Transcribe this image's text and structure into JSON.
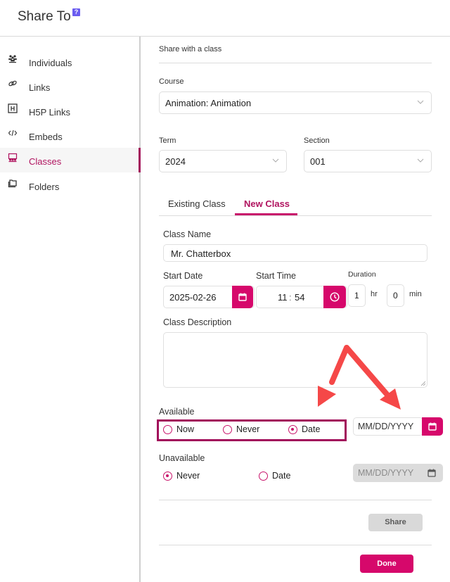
{
  "header": {
    "title": "Share To",
    "help_icon": "question-icon"
  },
  "sidebar": {
    "items": [
      {
        "label": "Individuals",
        "icon": "people-icon",
        "active": false
      },
      {
        "label": "Links",
        "icon": "link-icon",
        "active": false
      },
      {
        "label": "H5P Links",
        "icon": "h5p-icon",
        "active": false
      },
      {
        "label": "Embeds",
        "icon": "code-icon",
        "active": false
      },
      {
        "label": "Classes",
        "icon": "classroom-icon",
        "active": true
      },
      {
        "label": "Folders",
        "icon": "folder-icon",
        "active": false
      }
    ]
  },
  "main": {
    "section_title": "Share with a class",
    "course": {
      "label": "Course",
      "value": "Animation: Animation"
    },
    "term": {
      "label": "Term",
      "value": "2024"
    },
    "section": {
      "label": "Section",
      "value": "001"
    },
    "tabs": [
      {
        "label": "Existing Class",
        "active": false
      },
      {
        "label": "New Class",
        "active": true
      }
    ],
    "class_name": {
      "label": "Class Name",
      "value": "Mr. Chatterbox"
    },
    "start_date": {
      "label": "Start Date",
      "value": "2025-02-26"
    },
    "start_time": {
      "label": "Start Time",
      "hour": "11",
      "separator": ":",
      "minute": "54"
    },
    "duration": {
      "label": "Duration",
      "hours": "1",
      "hours_unit": "hr",
      "minutes": "0",
      "minutes_unit": "min"
    },
    "class_description": {
      "label": "Class Description",
      "value": ""
    },
    "available": {
      "label": "Available",
      "options": [
        {
          "label": "Now",
          "checked": false
        },
        {
          "label": "Never",
          "checked": false
        },
        {
          "label": "Date",
          "checked": true
        }
      ],
      "date_placeholder": "MM/DD/YYYY"
    },
    "unavailable": {
      "label": "Unavailable",
      "options": [
        {
          "label": "Never",
          "checked": true
        },
        {
          "label": "Date",
          "checked": false
        }
      ],
      "date_placeholder": "MM/DD/YYYY"
    },
    "share_button": "Share",
    "done_button": "Done"
  },
  "colors": {
    "accent": "#d6086b",
    "accent_dark": "#a20f5b",
    "annotation_arrow": "#f54848",
    "help_badge": "#6a5cf0"
  }
}
